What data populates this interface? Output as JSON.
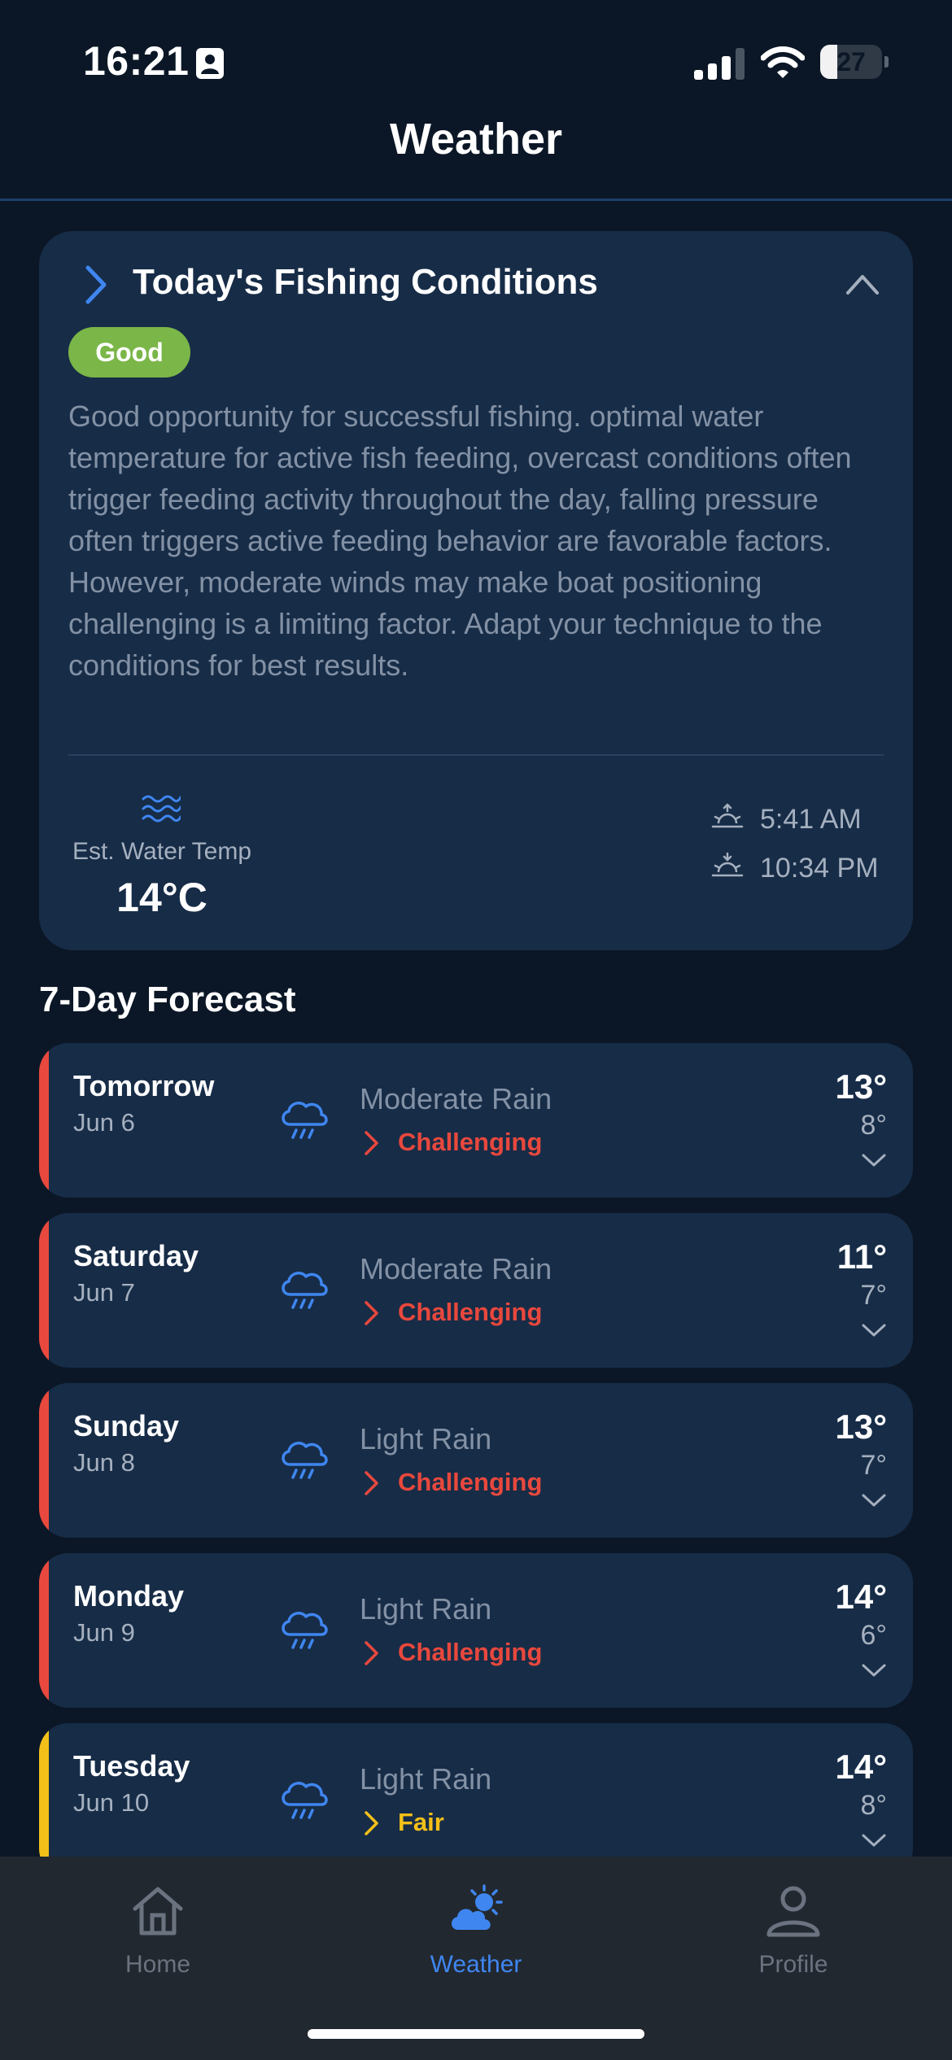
{
  "status_bar": {
    "time": "16:21",
    "battery": "27",
    "battery_level": 0.27
  },
  "header": {
    "title": "Weather"
  },
  "conditions": {
    "title": "Today's Fishing Conditions",
    "rating": "Good",
    "rating_color": "#7ab648",
    "description": "Good opportunity for successful fishing. optimal water temperature for active fish feeding, overcast conditions often trigger feeding activity throughout the day, falling pressure often triggers active feeding behavior are favorable factors. However, moderate winds may make boat positioning challenging is a limiting factor. Adapt your technique to the conditions for best results.",
    "water_temp_label": "Est. Water Temp",
    "water_temp": "14°C",
    "sunrise": "5:41 AM",
    "sunset": "10:34 PM"
  },
  "forecast": {
    "heading": "7-Day Forecast",
    "days": [
      {
        "day": "Tomorrow",
        "date": "Jun 6",
        "condition": "Moderate Rain",
        "rating": "Challenging",
        "rating_color": "#e8483d",
        "high": "13°",
        "low": "8°",
        "icon": "rain-cloud-icon"
      },
      {
        "day": "Saturday",
        "date": "Jun 7",
        "condition": "Moderate Rain",
        "rating": "Challenging",
        "rating_color": "#e8483d",
        "high": "11°",
        "low": "7°",
        "icon": "rain-cloud-icon"
      },
      {
        "day": "Sunday",
        "date": "Jun 8",
        "condition": "Light Rain",
        "rating": "Challenging",
        "rating_color": "#e8483d",
        "high": "13°",
        "low": "7°",
        "icon": "rain-cloud-icon"
      },
      {
        "day": "Monday",
        "date": "Jun 9",
        "condition": "Light Rain",
        "rating": "Challenging",
        "rating_color": "#e8483d",
        "high": "14°",
        "low": "6°",
        "icon": "rain-cloud-icon"
      },
      {
        "day": "Tuesday",
        "date": "Jun 10",
        "condition": "Light Rain",
        "rating": "Fair",
        "rating_color": "#f3c019",
        "high": "14°",
        "low": "8°",
        "icon": "rain-cloud-icon"
      }
    ]
  },
  "tabbar": {
    "home": "Home",
    "weather": "Weather",
    "profile": "Profile",
    "active_color": "#3f86f0",
    "inactive_color": "#6b7380"
  }
}
